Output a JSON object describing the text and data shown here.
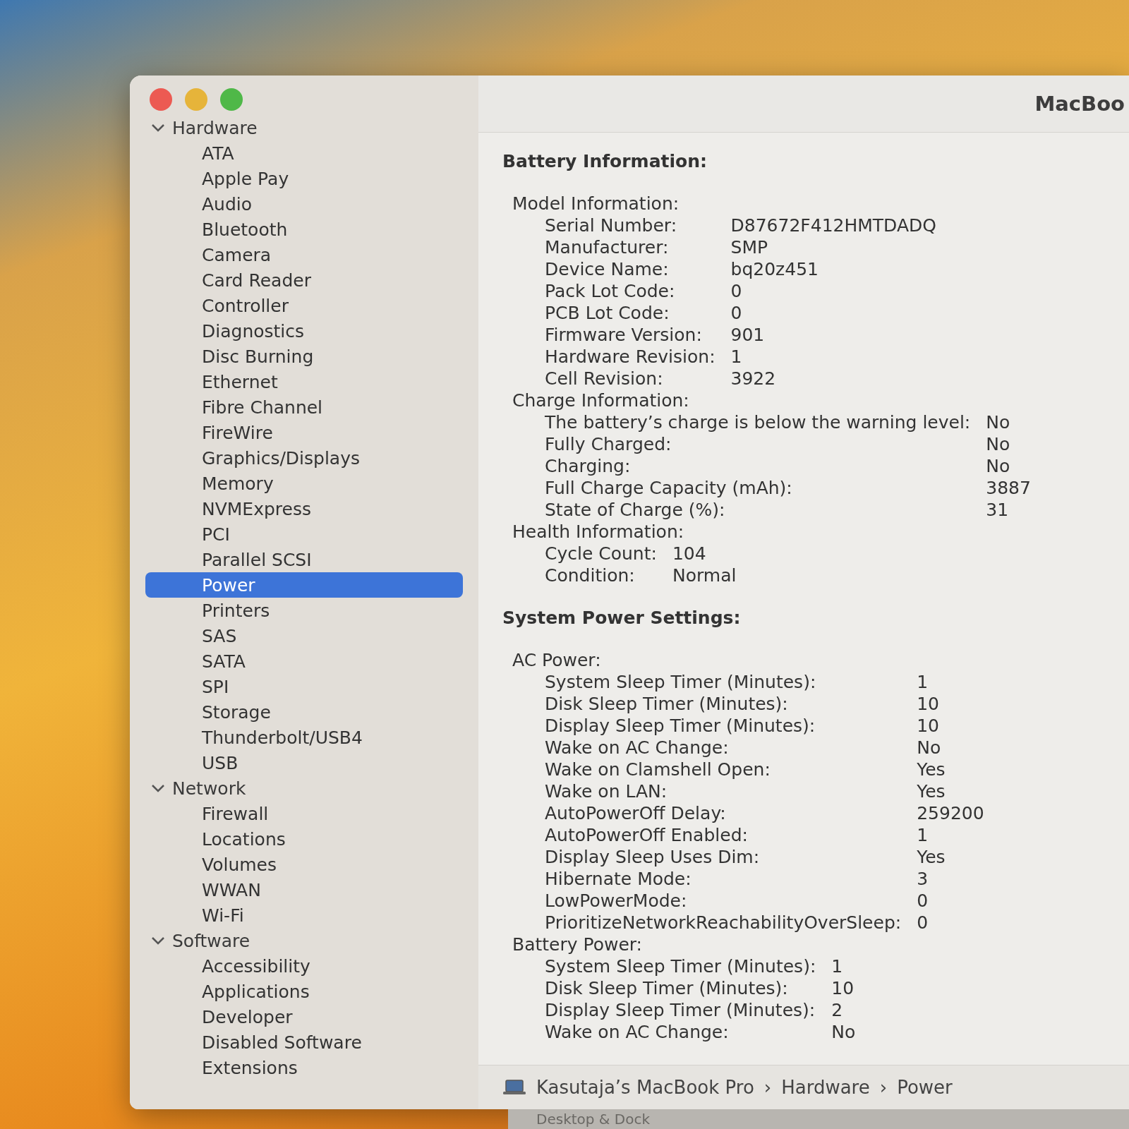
{
  "window": {
    "title": "MacBoo"
  },
  "sidebar": {
    "sections": [
      {
        "label": "Hardware",
        "expanded": true,
        "children": [
          {
            "label": "ATA",
            "selected": false
          },
          {
            "label": "Apple Pay",
            "selected": false
          },
          {
            "label": "Audio",
            "selected": false
          },
          {
            "label": "Bluetooth",
            "selected": false
          },
          {
            "label": "Camera",
            "selected": false
          },
          {
            "label": "Card Reader",
            "selected": false
          },
          {
            "label": "Controller",
            "selected": false
          },
          {
            "label": "Diagnostics",
            "selected": false
          },
          {
            "label": "Disc Burning",
            "selected": false
          },
          {
            "label": "Ethernet",
            "selected": false
          },
          {
            "label": "Fibre Channel",
            "selected": false
          },
          {
            "label": "FireWire",
            "selected": false
          },
          {
            "label": "Graphics/Displays",
            "selected": false
          },
          {
            "label": "Memory",
            "selected": false
          },
          {
            "label": "NVMExpress",
            "selected": false
          },
          {
            "label": "PCI",
            "selected": false
          },
          {
            "label": "Parallel SCSI",
            "selected": false
          },
          {
            "label": "Power",
            "selected": true
          },
          {
            "label": "Printers",
            "selected": false
          },
          {
            "label": "SAS",
            "selected": false
          },
          {
            "label": "SATA",
            "selected": false
          },
          {
            "label": "SPI",
            "selected": false
          },
          {
            "label": "Storage",
            "selected": false
          },
          {
            "label": "Thunderbolt/USB4",
            "selected": false
          },
          {
            "label": "USB",
            "selected": false
          }
        ]
      },
      {
        "label": "Network",
        "expanded": true,
        "children": [
          {
            "label": "Firewall",
            "selected": false
          },
          {
            "label": "Locations",
            "selected": false
          },
          {
            "label": "Volumes",
            "selected": false
          },
          {
            "label": "WWAN",
            "selected": false
          },
          {
            "label": "Wi-Fi",
            "selected": false
          }
        ]
      },
      {
        "label": "Software",
        "expanded": true,
        "children": [
          {
            "label": "Accessibility",
            "selected": false
          },
          {
            "label": "Applications",
            "selected": false
          },
          {
            "label": "Developer",
            "selected": false
          },
          {
            "label": "Disabled Software",
            "selected": false
          },
          {
            "label": "Extensions",
            "selected": false
          }
        ]
      }
    ]
  },
  "content": {
    "sections": [
      {
        "title": "Battery Information:",
        "groups": [
          {
            "title": "Model Information:",
            "rows": [
              {
                "label": "Serial Number:",
                "value": "D87672F412HMTDADQ"
              },
              {
                "label": "Manufacturer:",
                "value": "SMP"
              },
              {
                "label": "Device Name:",
                "value": "bq20z451"
              },
              {
                "label": "Pack Lot Code:",
                "value": "0"
              },
              {
                "label": "PCB Lot Code:",
                "value": "0"
              },
              {
                "label": "Firmware Version:",
                "value": "901"
              },
              {
                "label": "Hardware Revision:",
                "value": "1"
              },
              {
                "label": "Cell Revision:",
                "value": "3922"
              }
            ]
          },
          {
            "title": "Charge Information:",
            "rows": [
              {
                "label": "The battery’s charge is below the warning level:",
                "value": "No"
              },
              {
                "label": "Fully Charged:",
                "value": "No"
              },
              {
                "label": "Charging:",
                "value": "No"
              },
              {
                "label": "Full Charge Capacity (mAh):",
                "value": "3887"
              },
              {
                "label": "State of Charge (%):",
                "value": "31"
              }
            ]
          },
          {
            "title": "Health Information:",
            "rows": [
              {
                "label": "Cycle Count:",
                "value": "104"
              },
              {
                "label": "Condition:",
                "value": "Normal"
              }
            ]
          }
        ]
      },
      {
        "title": "System Power Settings:",
        "groups": [
          {
            "title": "AC Power:",
            "rows": [
              {
                "label": "System Sleep Timer (Minutes):",
                "value": "1"
              },
              {
                "label": "Disk Sleep Timer (Minutes):",
                "value": "10"
              },
              {
                "label": "Display Sleep Timer (Minutes):",
                "value": "10"
              },
              {
                "label": "Wake on AC Change:",
                "value": "No"
              },
              {
                "label": "Wake on Clamshell Open:",
                "value": "Yes"
              },
              {
                "label": "Wake on LAN:",
                "value": "Yes"
              },
              {
                "label": "AutoPowerOff Delay:",
                "value": "259200"
              },
              {
                "label": "AutoPowerOff Enabled:",
                "value": "1"
              },
              {
                "label": "Display Sleep Uses Dim:",
                "value": "Yes"
              },
              {
                "label": "Hibernate Mode:",
                "value": "3"
              },
              {
                "label": "LowPowerMode:",
                "value": "0"
              },
              {
                "label": "PrioritizeNetworkReachabilityOverSleep:",
                "value": "0"
              }
            ]
          },
          {
            "title": "Battery Power:",
            "rows": [
              {
                "label": "System Sleep Timer (Minutes):",
                "value": "1"
              },
              {
                "label": "Disk Sleep Timer (Minutes):",
                "value": "10"
              },
              {
                "label": "Display Sleep Timer (Minutes):",
                "value": "2"
              },
              {
                "label": "Wake on AC Change:",
                "value": "No"
              }
            ]
          }
        ]
      }
    ]
  },
  "path_bar": {
    "items": [
      "Kasutaja’s MacBook Pro",
      "›",
      "Hardware",
      "›",
      "Power"
    ]
  },
  "background_window": {
    "label": "Desktop & Dock"
  }
}
